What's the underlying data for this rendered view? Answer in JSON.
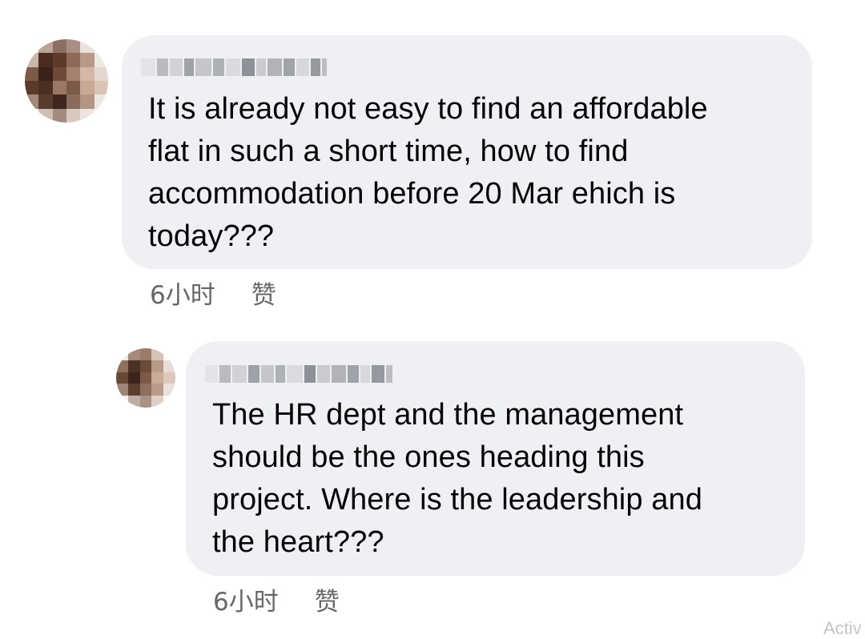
{
  "colors": {
    "bubble_bg": "#eff0f4",
    "meta_text": "#65676b",
    "body_text": "#050505"
  },
  "comments": [
    {
      "author": "",
      "text": "It is already not easy to find an affordable\nflat in such a short time, how to find\naccommodation before 20 Mar ehich is\ntoday???",
      "time": "6小时",
      "like_label": "赞"
    },
    {
      "author": "",
      "text": "The HR dept and the management\nshould be the ones heading this\nproject.  Where is the leadership and\nthe heart???",
      "time": "6小时",
      "like_label": "赞"
    }
  ],
  "watermark": "Activ"
}
